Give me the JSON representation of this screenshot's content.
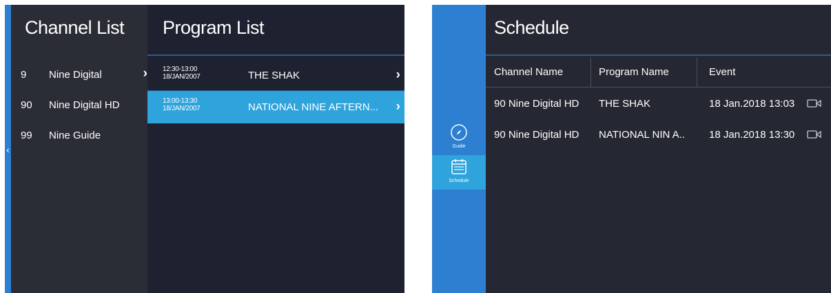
{
  "channel_list": {
    "title": "Channel List",
    "items": [
      {
        "number": "9",
        "name": "Nine Digital",
        "chevron": "›"
      },
      {
        "number": "90",
        "name": "Nine Digital HD"
      },
      {
        "number": "99",
        "name": "Nine Guide"
      }
    ]
  },
  "program_list": {
    "title": "Program List",
    "items": [
      {
        "time": "12:30-13:00",
        "date": "18/JAN/2007",
        "title": "THE SHAK",
        "chevron": "›"
      },
      {
        "time": "13:00-13:30",
        "date": "18/JAN/2007",
        "title": "NATIONAL NINE AFTERN...",
        "chevron": "›",
        "selected": true
      }
    ]
  },
  "left_edge_arrow": "‹",
  "side_nav": {
    "items": [
      {
        "label": "Guide",
        "icon": "compass-icon"
      },
      {
        "label": "Schedule",
        "icon": "calendar-icon",
        "active": true
      }
    ]
  },
  "schedule": {
    "title": "Schedule",
    "columns": [
      "Channel Name",
      "Program Name",
      "Event"
    ],
    "rows": [
      {
        "channel": "90 Nine Digital HD",
        "program": "THE SHAK",
        "event": "18 Jan.2018 13:03",
        "icon": "record-icon"
      },
      {
        "channel": "90 Nine Digital HD",
        "program": "NATIONAL NIN A..",
        "event": "18 Jan.2018 13:30",
        "icon": "record-icon"
      }
    ]
  },
  "colors": {
    "accent_blue": "#2d7fd1",
    "highlight_cyan": "#2ea3dc",
    "panel_dark": "#1e2230",
    "panel_mid": "#2b2d36"
  }
}
